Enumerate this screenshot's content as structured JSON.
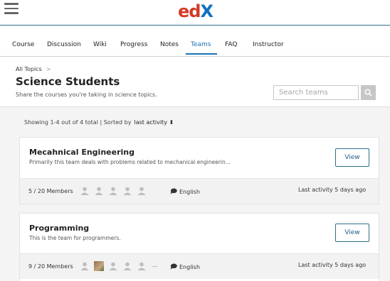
{
  "header": {
    "logo_ed": "ed",
    "logo_x": "X"
  },
  "tabs": [
    {
      "label": "Course",
      "active": false
    },
    {
      "label": "Discussion",
      "active": false
    },
    {
      "label": "Wiki",
      "active": false
    },
    {
      "label": "Progress",
      "active": false
    },
    {
      "label": "Notes",
      "active": false
    },
    {
      "label": "Teams",
      "active": true
    },
    {
      "label": "FAQ",
      "active": false
    },
    {
      "label": "Instructor",
      "active": false
    }
  ],
  "breadcrumb": {
    "label": "All Topics",
    "separator": ">"
  },
  "page": {
    "title": "Science Students",
    "subtitle": "Share the courses you're taking in science topics."
  },
  "search": {
    "placeholder": "Search teams",
    "icon": "search-icon"
  },
  "summary": {
    "text": "Showing 1-4 out of 4 total | Sorted by",
    "sort_label": "last activity",
    "sort_icon": "⬍"
  },
  "teams": [
    {
      "name": "Mecahnical Engineering",
      "description": "Primarily this team deals with problems related to mechanical engineerin...",
      "view_label": "View",
      "members": "5 / 20 Members",
      "avatars": [
        "placeholder",
        "placeholder",
        "placeholder",
        "placeholder",
        "placeholder"
      ],
      "more": "",
      "language": "English",
      "last_activity": "Last activity 5 days ago"
    },
    {
      "name": "Programming",
      "description": "This is the team for programmers.",
      "view_label": "View",
      "members": "9 / 20 Members",
      "avatars": [
        "placeholder",
        "photo",
        "placeholder",
        "placeholder",
        "placeholder"
      ],
      "more": "...",
      "language": "English",
      "last_activity": "Last activity 5 days ago"
    }
  ],
  "colors": {
    "accent": "#1c74b6",
    "logo_red": "#d33a26",
    "logo_blue": "#0e6fc0",
    "button_border": "#2f6f8f"
  }
}
